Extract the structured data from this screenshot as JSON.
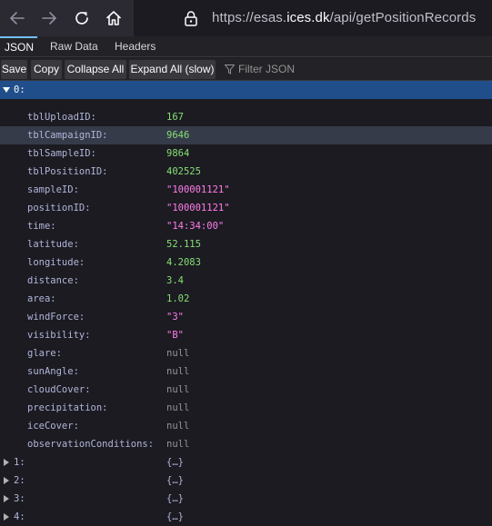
{
  "browser": {
    "url_prefix": "https://esas.",
    "url_host": "ices.dk",
    "url_path": "/api/getPositionRecords"
  },
  "tabs": {
    "json": "JSON",
    "raw": "Raw Data",
    "headers": "Headers"
  },
  "toolbar": {
    "save": "Save",
    "copy": "Copy",
    "collapse": "Collapse All",
    "expand": "Expand All (slow)",
    "filter_placeholder": "Filter JSON"
  },
  "root_key": "0:",
  "fields": [
    {
      "key": "tblUploadID:",
      "value": "167",
      "kind": "num"
    },
    {
      "key": "tblCampaignID:",
      "value": "9646",
      "kind": "num"
    },
    {
      "key": "tblSampleID:",
      "value": "9864",
      "kind": "num"
    },
    {
      "key": "tblPositionID:",
      "value": "402525",
      "kind": "num"
    },
    {
      "key": "sampleID:",
      "value": "\"100001121\"",
      "kind": "str"
    },
    {
      "key": "positionID:",
      "value": "\"100001121\"",
      "kind": "str"
    },
    {
      "key": "time:",
      "value": "\"14:34:00\"",
      "kind": "str"
    },
    {
      "key": "latitude:",
      "value": "52.115",
      "kind": "num"
    },
    {
      "key": "longitude:",
      "value": "4.2083",
      "kind": "num"
    },
    {
      "key": "distance:",
      "value": "3.4",
      "kind": "num"
    },
    {
      "key": "area:",
      "value": "1.02",
      "kind": "num"
    },
    {
      "key": "windForce:",
      "value": "\"3\"",
      "kind": "str"
    },
    {
      "key": "visibility:",
      "value": "\"B\"",
      "kind": "str"
    },
    {
      "key": "glare:",
      "value": "null",
      "kind": "null"
    },
    {
      "key": "sunAngle:",
      "value": "null",
      "kind": "null"
    },
    {
      "key": "cloudCover:",
      "value": "null",
      "kind": "null"
    },
    {
      "key": "precipitation:",
      "value": "null",
      "kind": "null"
    },
    {
      "key": "iceCover:",
      "value": "null",
      "kind": "null"
    },
    {
      "key": "observationConditions:",
      "value": "null",
      "kind": "null"
    }
  ],
  "collapsed": [
    {
      "key": "1:",
      "value": "{…}"
    },
    {
      "key": "2:",
      "value": "{…}"
    },
    {
      "key": "3:",
      "value": "{…}"
    },
    {
      "key": "4:",
      "value": "{…}"
    }
  ],
  "colors": {
    "accent": "#75bfff",
    "selection": "#204e8a",
    "number": "#86de74",
    "string": "#ff7de9",
    "null": "#939395"
  }
}
